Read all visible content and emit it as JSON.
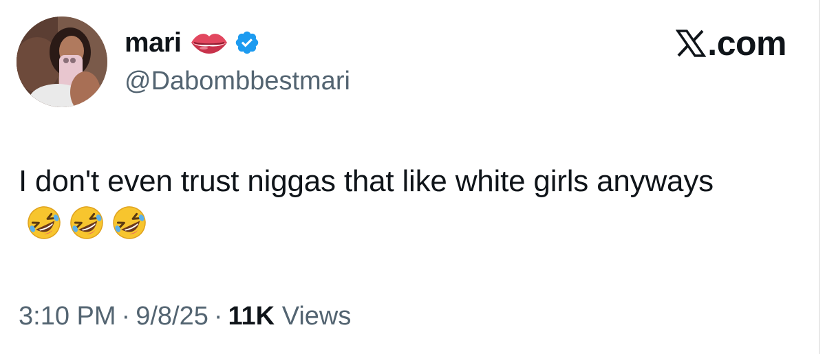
{
  "user": {
    "display_name": "mari",
    "handle": "@Dabombbestmari",
    "verified": true,
    "name_emoji": "lips-emoji"
  },
  "brand": {
    "label": ".com",
    "logo": "x-logo-icon"
  },
  "tweet": {
    "text": "I don't even trust niggas that like white girls anyways",
    "trailing_emojis": [
      "rolling-on-floor-laughing-emoji",
      "rolling-on-floor-laughing-emoji",
      "rolling-on-floor-laughing-emoji"
    ]
  },
  "meta": {
    "time": "3:10 PM",
    "separator": "·",
    "date": "9/8/25",
    "views_count": "11K",
    "views_label": "Views"
  },
  "colors": {
    "text_primary": "#0f1419",
    "text_secondary": "#536471",
    "verified_blue": "#1d9bf0"
  }
}
